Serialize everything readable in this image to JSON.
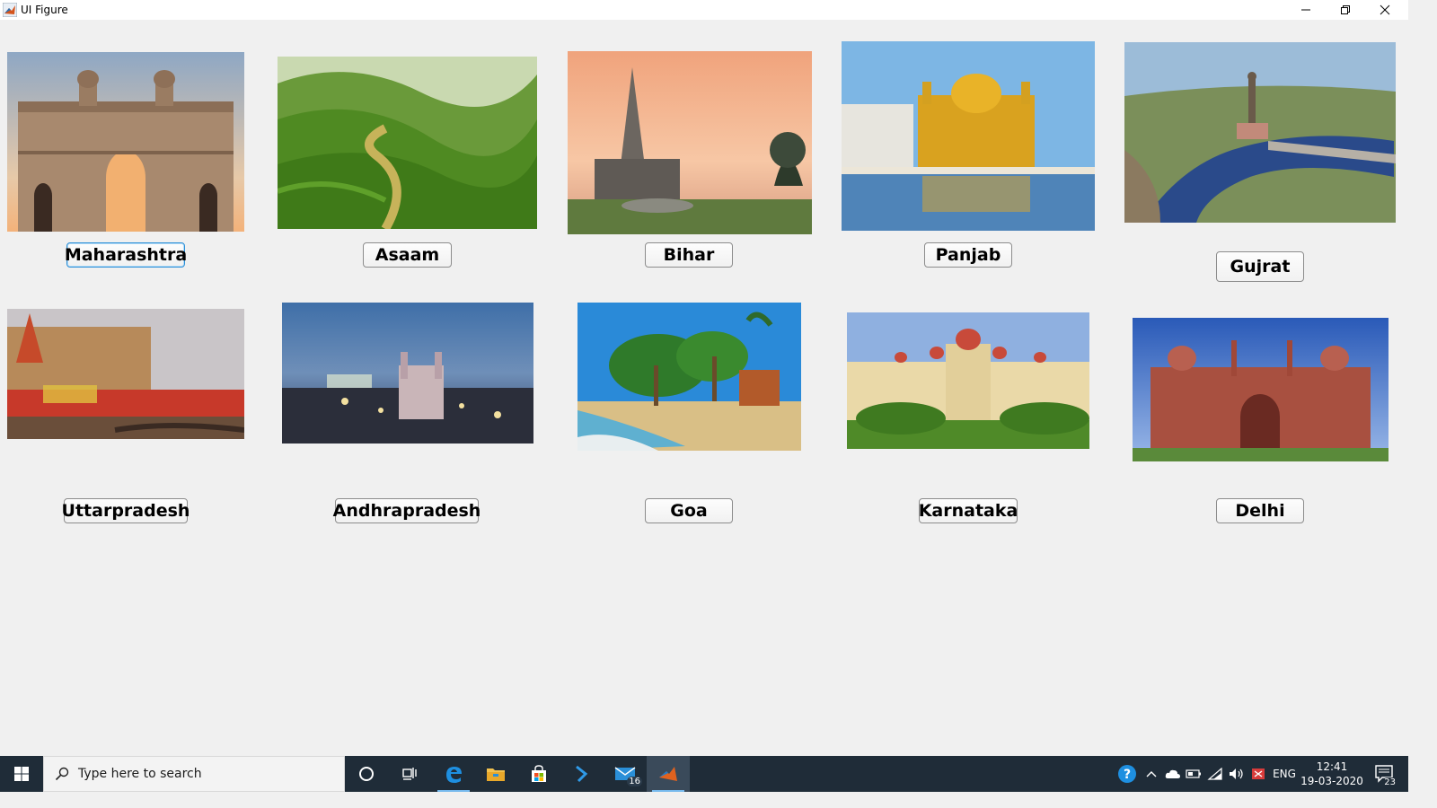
{
  "window": {
    "title": "UI Figure",
    "minimize_icon": "minimize-icon",
    "restore_icon": "restore-icon",
    "close_icon": "close-icon"
  },
  "states": [
    {
      "label": "Maharashtra",
      "image": "gateway-of-india"
    },
    {
      "label": "Asaam",
      "image": "tea-garden-hills"
    },
    {
      "label": "Bihar",
      "image": "mahabodhi-temple"
    },
    {
      "label": "Panjab",
      "image": "golden-temple"
    },
    {
      "label": "Gujrat",
      "image": "statue-of-unity"
    },
    {
      "label": "Uttarpradesh",
      "image": "varanasi-ghats"
    },
    {
      "label": "Andhrapradesh",
      "image": "charminar-city"
    },
    {
      "label": "Goa",
      "image": "palm-beach"
    },
    {
      "label": "Karnataka",
      "image": "mysore-palace"
    },
    {
      "label": "Delhi",
      "image": "red-fort"
    }
  ],
  "taskbar": {
    "search_placeholder": "Type here to search",
    "mail_badge": "16",
    "language": "ENG",
    "time": "12:41",
    "date": "19-03-2020",
    "notification_count": "23",
    "icons": [
      "windows-start-icon",
      "search-icon",
      "cortana-icon",
      "task-view-icon",
      "edge-icon",
      "file-explorer-icon",
      "store-icon",
      "vscode-icon",
      "mail-icon",
      "matlab-icon"
    ]
  },
  "colors": {
    "background": "#f0f0f0",
    "taskbar": "#1f2c38",
    "focus_border": "#2b8fd8"
  }
}
